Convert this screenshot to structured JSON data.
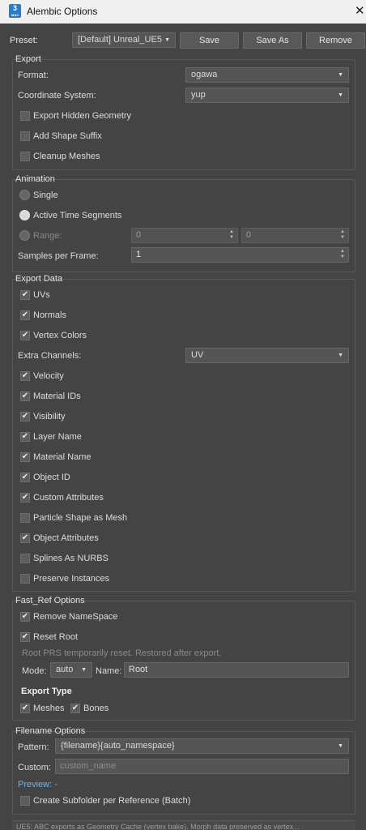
{
  "window": {
    "title": "Alembic Options",
    "icon_text": "3",
    "icon_sub": "MAX",
    "close_glyph": "✕",
    "app_icon": "3dsmax-icon",
    "close_icon": "close-icon"
  },
  "preset": {
    "label": "Preset:",
    "value": "[Default] Unreal_UE5",
    "save": "Save",
    "save_as": "Save As",
    "remove": "Remove"
  },
  "export": {
    "title": "Export",
    "format_label": "Format:",
    "format_value": "ogawa",
    "coord_label": "Coordinate System:",
    "coord_value": "yup",
    "hidden_geometry": "Export Hidden Geometry",
    "shape_suffix": "Add Shape Suffix",
    "cleanup_meshes": "Cleanup Meshes"
  },
  "animation": {
    "title": "Animation",
    "single": "Single",
    "active_segments": "Active Time Segments",
    "range": "Range:",
    "range_start": "0",
    "range_end": "0",
    "samples_label": "Samples per Frame:",
    "samples_value": "1"
  },
  "export_data": {
    "title": "Export Data",
    "uvs": "UVs",
    "normals": "Normals",
    "vertex_colors": "Vertex Colors",
    "extra_channels_label": "Extra Channels:",
    "extra_channels_value": "UV",
    "velocity": "Velocity",
    "material_ids": "Material IDs",
    "visibility": "Visibility",
    "layer_name": "Layer Name",
    "material_name": "Material Name",
    "object_id": "Object ID",
    "custom_attributes": "Custom Attributes",
    "particle_shape": "Particle Shape as Mesh",
    "object_attributes": "Object Attributes",
    "splines_nurbs": "Splines As NURBS",
    "preserve_instances": "Preserve Instances"
  },
  "fast_ref": {
    "title": "Fast_Ref Options",
    "remove_namespace": "Remove NameSpace",
    "reset_root": "Reset Root",
    "note": "Root PRS temporarily reset. Restored after export.",
    "mode_label": "Mode:",
    "mode_value": "auto",
    "name_label": "Name:",
    "name_value": "Root",
    "export_type_label": "Export Type",
    "meshes": "Meshes",
    "bones": "Bones"
  },
  "filename": {
    "title": "Filename Options",
    "pattern_label": "Pattern:",
    "pattern_value": "{filename}{auto_namespace}",
    "custom_label": "Custom:",
    "custom_placeholder": "custom_name",
    "preview_label": "Preview: -",
    "subfolder": "Create Subfolder per Reference (Batch)"
  },
  "footer": {
    "text": "UE5: ABC exports as Geometry Cache (vertex bake). Morph data preserved as vertex..."
  },
  "glyphs": {
    "check": "✔",
    "dropdown": "▼",
    "spin_up": "▲",
    "spin_down": "▼"
  },
  "colors": {
    "background": "#444444",
    "titlebar": "#f0f0f0",
    "accent_link": "#6fb4ea"
  }
}
